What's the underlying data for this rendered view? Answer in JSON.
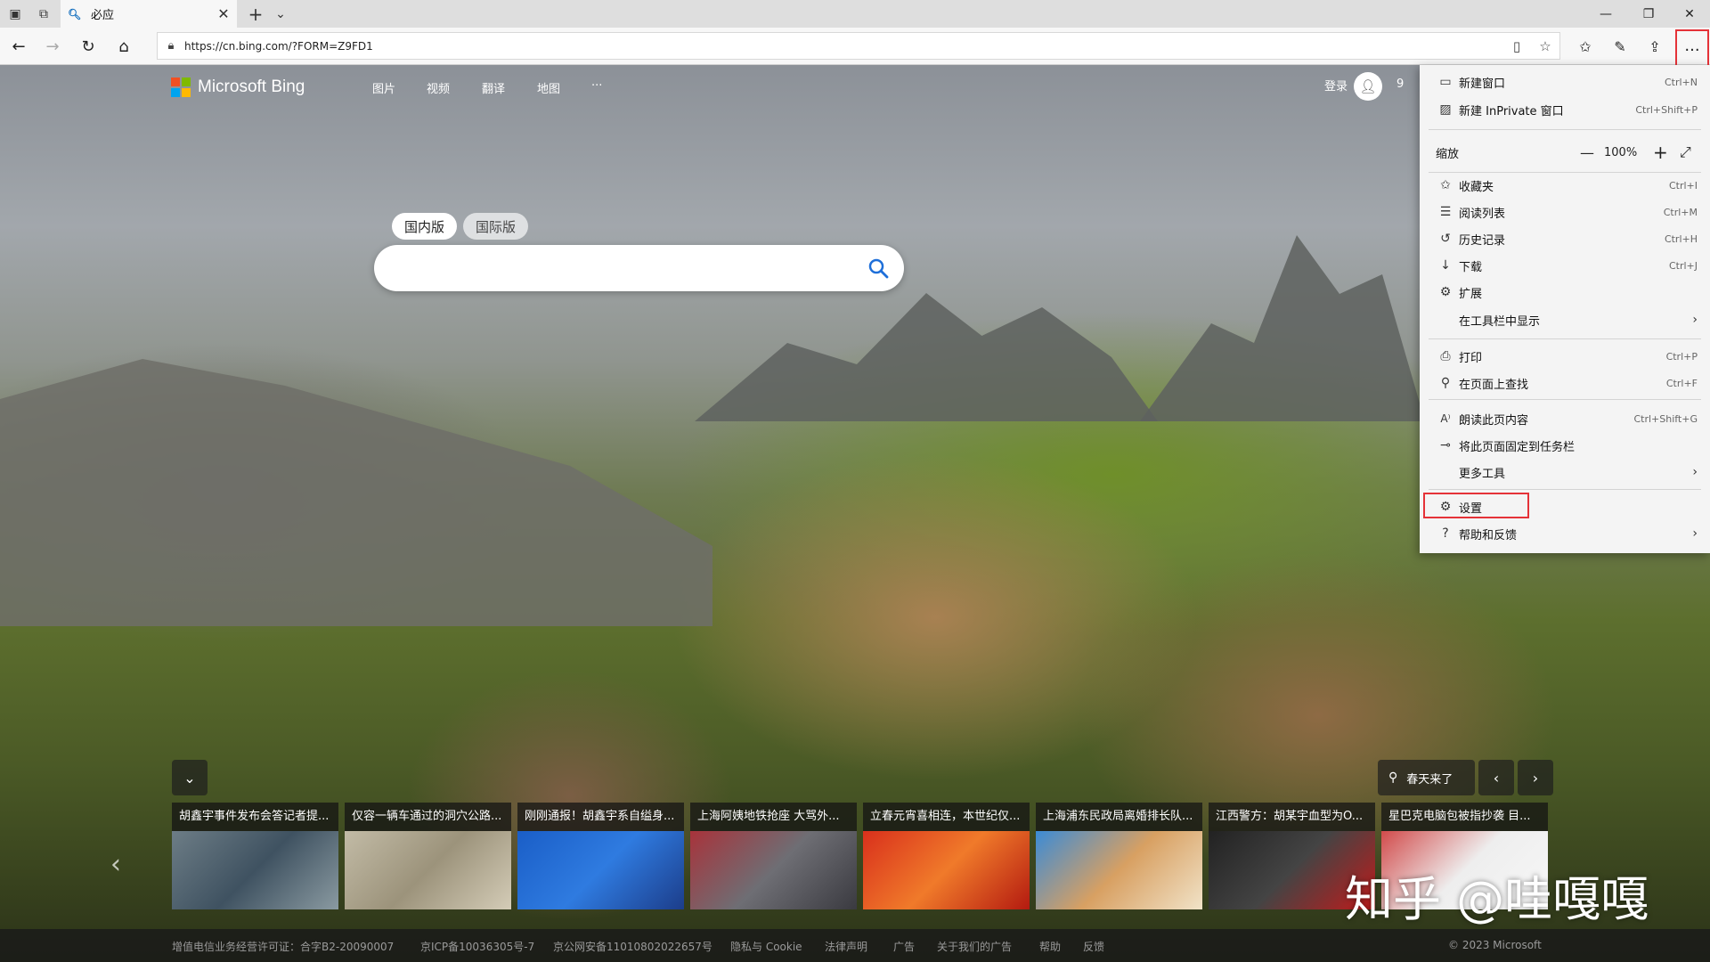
{
  "browser": {
    "tab_title": "必应",
    "favicon": "bing-search-glyph",
    "new_tab_symbol": "+",
    "url": "https://cn.bing.com/?FORM=Z9FD1"
  },
  "bing": {
    "brand": "Microsoft Bing",
    "logo_colors": [
      "#f25022",
      "#7fba00",
      "#00a4ef",
      "#ffb900"
    ],
    "nav": [
      "图片",
      "视频",
      "翻译",
      "地图",
      "···"
    ],
    "signin": "登录",
    "rewards": "9",
    "scope_tabs": [
      "国内版",
      "国际版"
    ],
    "search_placeholder": "",
    "location": "春天来了",
    "news": [
      "胡鑫宇事件发布会答记者提...",
      "仅容一辆车通过的洞穴公路...",
      "刚刚通报！胡鑫宇系自缢身...",
      "上海阿姨地铁抢座 大骂外...",
      "立春元宵喜相连，本世纪仅...",
      "上海浦东民政局离婚排长队...",
      "江西警方：胡某宇血型为O...",
      "星巴克电脑包被指抄袭 目..."
    ],
    "footer": [
      "增值电信业务经营许可证：合字B2-20090007",
      "京ICP备10036305号-7",
      "京公网安备11010802022657号",
      "隐私与 Cookie",
      "法律声明",
      "广告",
      "关于我们的广告",
      "帮助",
      "反馈",
      "© 2023 Microsoft"
    ]
  },
  "menu": {
    "new_window": {
      "label": "新建窗口",
      "shortcut": "Ctrl+N"
    },
    "new_inprivate": {
      "label": "新建 InPrivate 窗口",
      "shortcut": "Ctrl+Shift+P"
    },
    "zoom": {
      "label": "缩放",
      "value": "100%",
      "minus": "—",
      "plus": "+"
    },
    "favorites": {
      "label": "收藏夹",
      "shortcut": "Ctrl+I"
    },
    "reading_list": {
      "label": "阅读列表",
      "shortcut": "Ctrl+M"
    },
    "history": {
      "label": "历史记录",
      "shortcut": "Ctrl+H"
    },
    "downloads": {
      "label": "下载",
      "shortcut": "Ctrl+J"
    },
    "extensions": {
      "label": "扩展"
    },
    "show_in_toolbar": {
      "label": "在工具栏中显示"
    },
    "print": {
      "label": "打印",
      "shortcut": "Ctrl+P"
    },
    "find": {
      "label": "在页面上查找",
      "shortcut": "Ctrl+F"
    },
    "read_aloud": {
      "label": "朗读此页内容",
      "shortcut": "Ctrl+Shift+G"
    },
    "pin_taskbar": {
      "label": "将此页面固定到任务栏"
    },
    "more_tools": {
      "label": "更多工具"
    },
    "settings": {
      "label": "设置"
    },
    "help": {
      "label": "帮助和反馈"
    }
  },
  "watermark": "知乎 @哇嘎嘎",
  "highlight_color": "#e53238"
}
